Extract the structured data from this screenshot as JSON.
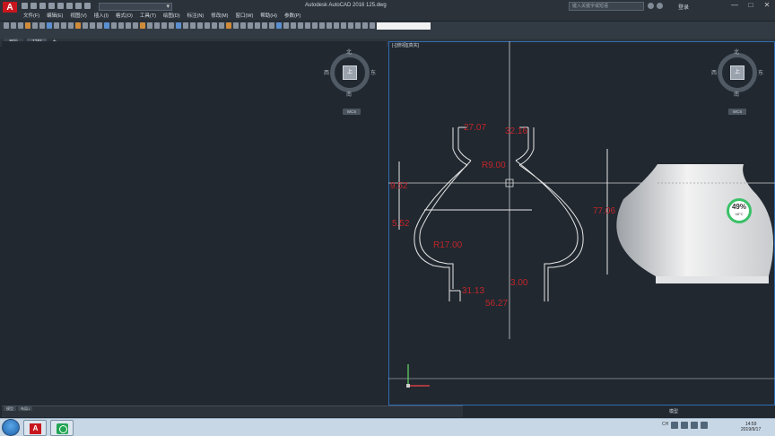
{
  "window": {
    "title": "Autodesk AutoCAD 2016    125.dwg",
    "search_placeholder": "键入关键字或短语",
    "login_label": "登录",
    "minimize": "—",
    "maximize": "□",
    "close": "✕"
  },
  "menu": [
    "文件(F)",
    "编辑(E)",
    "视图(V)",
    "插入(I)",
    "格式(O)",
    "工具(T)",
    "绘图(D)",
    "标注(N)",
    "修改(M)",
    "窗口(W)",
    "帮助(H)",
    "参数(P)"
  ],
  "tabs": [
    {
      "label": "开始"
    },
    {
      "label": "125*"
    }
  ],
  "tab_add": "+",
  "viewport": {
    "label": "[-][俯视][真实]"
  },
  "viewcube": {
    "face": "上",
    "north": "北",
    "south": "南",
    "west": "西",
    "east": "东",
    "wcs": "WCS"
  },
  "dimensions": [
    "27.07",
    "32.16",
    "R9.00",
    "9.52",
    "5.52",
    "77.06",
    "R17.00",
    "31.13",
    "3.00",
    "56.27"
  ],
  "widget": {
    "percent": "49%",
    "temp": "48°C"
  },
  "layout_tabs": [
    "模型",
    "布局1"
  ],
  "statusbar": {
    "model": "模型"
  },
  "tray": {
    "lang": "CH"
  },
  "clock": {
    "time": "14:59",
    "date": "2019/9/17"
  },
  "colors": {
    "accent": "#2f6cb4",
    "dimension": "#c0262a",
    "background": "#212830"
  }
}
